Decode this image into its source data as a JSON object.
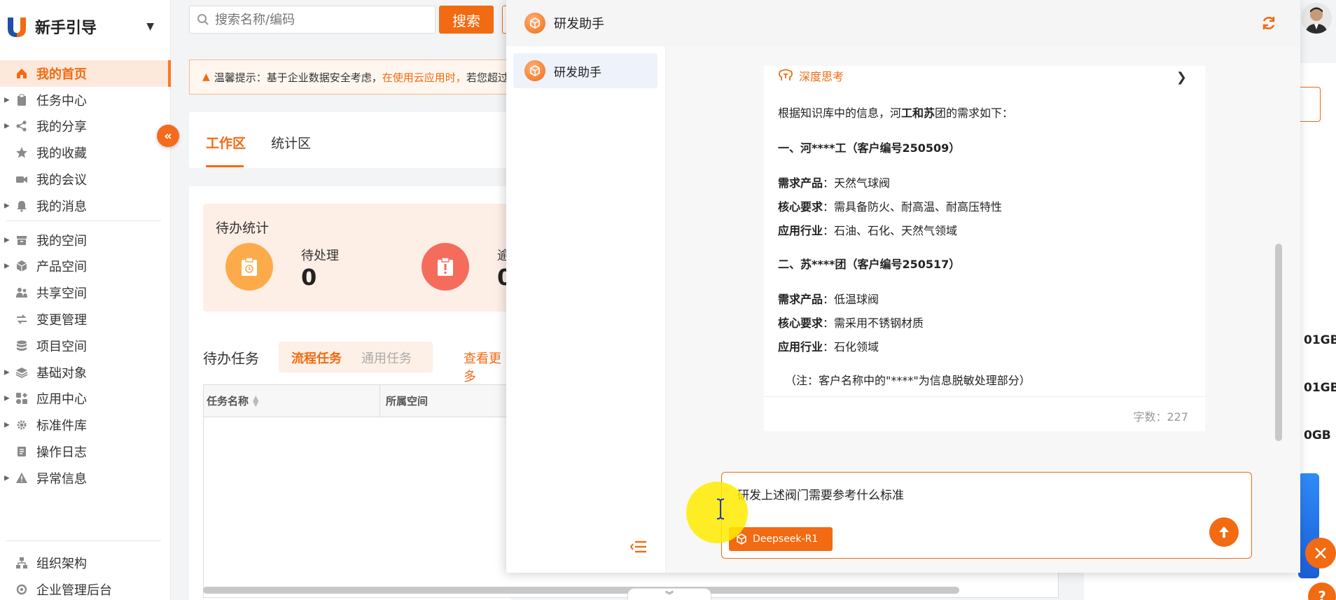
{
  "sidebar": {
    "brand": "新手引导",
    "items": [
      {
        "label": "我的首页",
        "icon": "home-icon",
        "caret": false,
        "active": true
      },
      {
        "label": "任务中心",
        "icon": "clipboard-icon",
        "caret": true
      },
      {
        "label": "我的分享",
        "icon": "share-icon",
        "caret": true
      },
      {
        "label": "我的收藏",
        "icon": "star-icon",
        "caret": false
      },
      {
        "label": "我的会议",
        "icon": "video-icon",
        "caret": false
      },
      {
        "label": "我的消息",
        "icon": "bell-icon",
        "caret": true
      },
      {
        "label": "我的空间",
        "icon": "box-icon",
        "caret": true
      },
      {
        "label": "产品空间",
        "icon": "cube-icon",
        "caret": true
      },
      {
        "label": "共享空间",
        "icon": "users-icon",
        "caret": false
      },
      {
        "label": "变更管理",
        "icon": "change-icon",
        "caret": false
      },
      {
        "label": "项目空间",
        "icon": "database-icon",
        "caret": false
      },
      {
        "label": "基础对象",
        "icon": "layers-icon",
        "caret": true
      },
      {
        "label": "应用中心",
        "icon": "apps-icon",
        "caret": true
      },
      {
        "label": "标准件库",
        "icon": "gear-icon",
        "caret": true
      },
      {
        "label": "操作日志",
        "icon": "log-icon",
        "caret": false
      },
      {
        "label": "异常信息",
        "icon": "warning-icon",
        "caret": true
      }
    ],
    "bottom_items": [
      {
        "label": "组织架构",
        "icon": "org-icon"
      },
      {
        "label": "企业管理后台",
        "icon": "settings-icon"
      }
    ]
  },
  "search": {
    "placeholder": "搜索名称/编码",
    "button": "搜索"
  },
  "notice": {
    "prefix": "温馨提示：基于企业数据安全考虑，",
    "highlight": "在使用云应用时，",
    "suffix": "若您超过"
  },
  "tabs": [
    "工作区",
    "统计区"
  ],
  "todo": {
    "title": "待办统计",
    "pending_label": "待处理",
    "pending_value": "0",
    "overdue_label": "逾",
    "overdue_value": "0"
  },
  "tasks": {
    "title": "待办任务",
    "tab_flow": "流程任务",
    "tab_general": "通用任务",
    "view_more": "查看更多",
    "columns": [
      "任务名称",
      "所属空间"
    ]
  },
  "storage": [
    "01GB",
    "01GB",
    "0GB"
  ],
  "chat": {
    "title": "研发助手",
    "session": "研发助手",
    "think_label": "深度思考",
    "message": {
      "intro_a": "根据知识库中的信息，河",
      "intro_b": "工和苏",
      "intro_c": "团的需求如下：",
      "sec1": "一、河****工（客户编号250509）",
      "sec1_rows": [
        {
          "k": "需求产品",
          "v": "：天然气球阀"
        },
        {
          "k": "核心要求",
          "v": "：需具备防火、耐高温、耐高压特性"
        },
        {
          "k": "应用行业",
          "v": "：石油、石化、天然气领域"
        }
      ],
      "sec2": "二、苏****团（客户编号250517）",
      "sec2_rows": [
        {
          "k": "需求产品",
          "v": "：低温球阀"
        },
        {
          "k": "核心要求",
          "v": "：需采用不锈钢材质"
        },
        {
          "k": "应用行业",
          "v": "：石化领域"
        }
      ],
      "note": "（注：客户名称中的\"****\"为信息脱敏处理部分）",
      "word_count": "字数：227"
    },
    "input_value": "研发上述阀门需要参考什么标准",
    "model": "Deepseek-R1"
  },
  "colors": {
    "accent": "#f26a11",
    "active_bg": "#fde9dc"
  }
}
